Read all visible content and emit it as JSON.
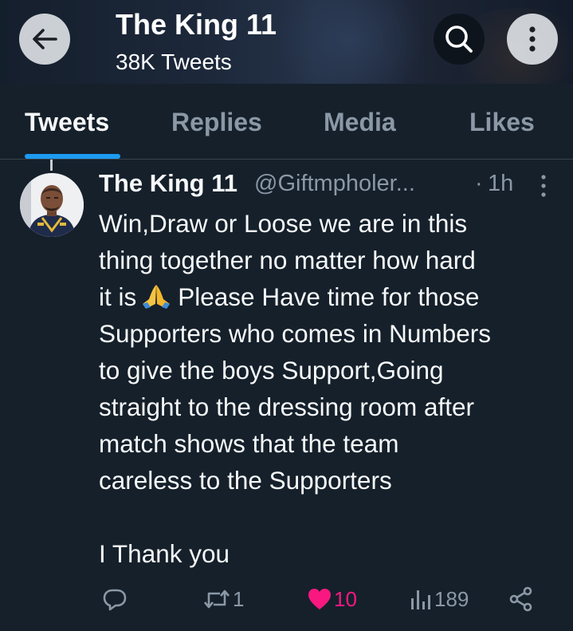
{
  "header": {
    "title": "The King 11",
    "subtitle": "38K Tweets"
  },
  "tabs": [
    {
      "label": "Tweets",
      "active": true
    },
    {
      "label": "Replies",
      "active": false
    },
    {
      "label": "Media",
      "active": false
    },
    {
      "label": "Likes",
      "active": false
    }
  ],
  "tweet": {
    "name": "The King 11",
    "handle": "@Giftmpholer...",
    "dot": "·",
    "time": "1h",
    "lines": [
      "Win,Draw or Loose we are in this",
      "thing together no matter how hard",
      "it is",
      "Please Have time for those",
      "Supporters who comes in Numbers",
      "to give the boys Support,Going",
      "straight to the dressing room after",
      "match shows that the team",
      "careless to the Supporters",
      "I Thank you"
    ],
    "actions": {
      "replies": "",
      "retweets": "1",
      "likes": "10",
      "views": "189"
    }
  },
  "colors": {
    "background": "#15202b",
    "accent": "#1d9bf0",
    "like": "#f91880",
    "muted": "#8b98a5"
  },
  "icons": [
    "back-arrow-icon",
    "search-icon",
    "more-vertical-icon",
    "folded-hands-emoji",
    "reply-icon",
    "retweet-icon",
    "heart-icon",
    "views-icon",
    "share-icon"
  ]
}
